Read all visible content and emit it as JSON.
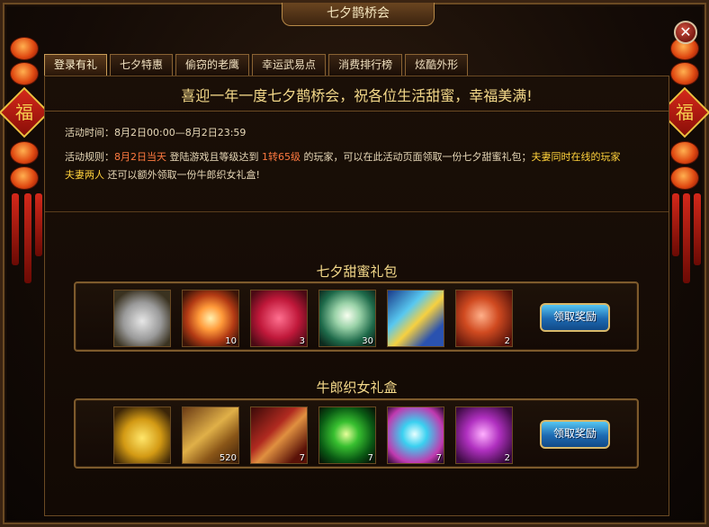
{
  "window": {
    "title": "七夕鹊桥会",
    "close_symbol": "✕"
  },
  "decor": {
    "fu_char": "福"
  },
  "tabs": [
    {
      "label": "登录有礼",
      "active": true
    },
    {
      "label": "七夕特惠",
      "active": false
    },
    {
      "label": "偷窃的老鹰",
      "active": false
    },
    {
      "label": "幸运武易点",
      "active": false
    },
    {
      "label": "消费排行榜",
      "active": false
    },
    {
      "label": "炫酷外形",
      "active": false
    }
  ],
  "headline": "喜迎一年一度七夕鹊桥会，祝各位生活甜蜜，幸福美满!",
  "activity": {
    "time_label": "活动时间：",
    "time_value": "8月2日00:00—8月2日23:59",
    "rule_label": "活动规则：",
    "rule_date": "8月2日当天",
    "rule_text1": " 登陆游戏且等级达到 ",
    "rule_level": "1转65级",
    "rule_text2": " 的玩家，可以在此活动页面领取一份七夕甜蜜礼包；",
    "rule_couple_online": "夫妻同时在线的玩家",
    "rule_couple": "夫妻两人",
    "rule_text3": " 还可以额外领取一份牛郎织女礼盒!"
  },
  "gift1": {
    "title": "七夕甜蜜礼包",
    "claim_label": "领取奖励",
    "items": [
      {
        "icon": "silver-ingot-icon",
        "qty": ""
      },
      {
        "icon": "fireworks-icon",
        "qty": "10"
      },
      {
        "icon": "heart-box-icon",
        "qty": "3"
      },
      {
        "icon": "jade-egg-icon",
        "qty": "30"
      },
      {
        "icon": "blue-card-icon",
        "qty": ""
      },
      {
        "icon": "red-orb-icon",
        "qty": "2"
      }
    ]
  },
  "gift2": {
    "title": "牛郎织女礼盒",
    "claim_label": "领取奖励",
    "items": [
      {
        "icon": "gold-ingot-icon",
        "qty": ""
      },
      {
        "icon": "bank-note-icon",
        "qty": "520"
      },
      {
        "icon": "red-scroll-icon",
        "qty": "7"
      },
      {
        "icon": "green-orb-icon",
        "qty": "7"
      },
      {
        "icon": "blue-pearl-icon",
        "qty": "7"
      },
      {
        "icon": "purple-orb-icon",
        "qty": "2"
      }
    ]
  },
  "colors": {
    "accent_gold": "#f4d98a",
    "highlight_red": "#ff7a40",
    "highlight_yellow": "#ffd23c",
    "button_blue": "#1d6ab2"
  }
}
